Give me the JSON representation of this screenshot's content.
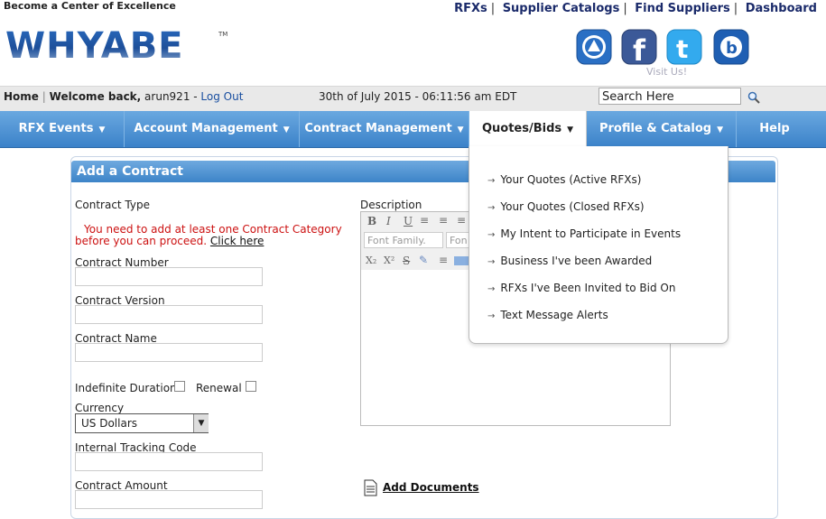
{
  "header": {
    "tagline": "Become a Center of Excellence",
    "logo_text": "WHYABE",
    "top_links": [
      "RFXs",
      "Supplier Catalogs",
      "Find Suppliers",
      "Dashboard"
    ],
    "visit_us": "Visit Us!"
  },
  "welcome": {
    "home": "Home",
    "welcome_back": "Welcome back,",
    "username": "arun921",
    "logout": "Log Out",
    "datetime": "30th of July 2015 - 06:11:56 am EDT",
    "search_value": "Search Here"
  },
  "nav": {
    "items": [
      {
        "label": "RFX Events"
      },
      {
        "label": "Account Management"
      },
      {
        "label": "Contract Management"
      },
      {
        "label": "Quotes/Bids"
      },
      {
        "label": "Profile & Catalog"
      },
      {
        "label": "Help"
      }
    ]
  },
  "dropdown": {
    "items": [
      "Your Quotes (Active RFXs)",
      "Your Quotes (Closed RFXs)",
      "My Intent to Participate in Events",
      "Business I've been Awarded",
      "RFXs I've Been Invited to Bid On",
      "Text Message Alerts"
    ]
  },
  "form": {
    "title": "Add a Contract",
    "contract_type": "Contract Type",
    "error_line1": "You need to add at least one Contract Category",
    "error_line2": "before you can proceed.",
    "click_here": "Click here",
    "contract_number": "Contract Number",
    "contract_version": "Contract Version",
    "contract_name": "Contract Name",
    "indefinite_duration": "Indefinite Duration",
    "renewal": "Renewal",
    "currency": "Currency",
    "currency_value": "US Dollars",
    "internal_tracking_code": "Internal Tracking Code",
    "contract_amount": "Contract Amount",
    "description": "Description",
    "font_family": "Font Family.",
    "font_size": "Fon",
    "add_documents": "Add Documents"
  },
  "colors": {
    "nav_blue": "#3b82c9",
    "error_red": "#cc1111",
    "facebook": "#3b5998",
    "twitter": "#33aaee"
  }
}
